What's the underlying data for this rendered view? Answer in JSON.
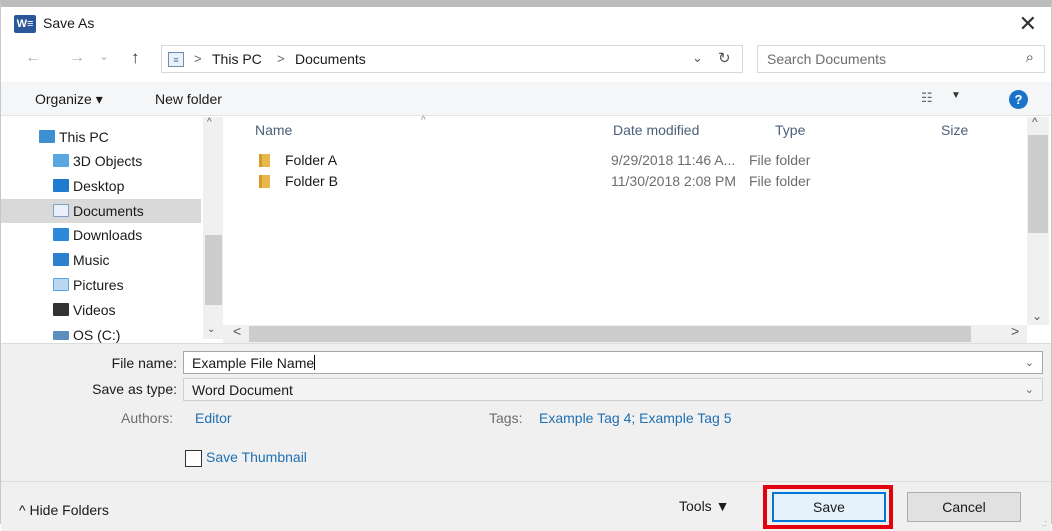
{
  "window": {
    "title": "Save As",
    "app_icon_text": "W≡",
    "close_glyph": "✕"
  },
  "nav": {
    "back_glyph": "←",
    "forward_glyph": "→",
    "recent_glyph": "⌄",
    "up_glyph": "↑",
    "address": {
      "crumbs": [
        "This PC",
        "Documents"
      ],
      "separator": ">",
      "dropdown_glyph": "⌄",
      "refresh_glyph": "↻"
    },
    "search": {
      "placeholder": "Search Documents",
      "icon_glyph": "⌕"
    }
  },
  "toolbar": {
    "organize_label": "Organize ▾",
    "new_folder_label": "New folder",
    "view_glyph": "☷",
    "view_caret": "▼",
    "help_glyph": "?"
  },
  "sidebar": {
    "items": [
      {
        "label": "This PC",
        "icon": "computer-icon",
        "color": "#3d8fd1"
      },
      {
        "label": "3D Objects",
        "icon": "cube-icon",
        "color": "#5aa6e0"
      },
      {
        "label": "Desktop",
        "icon": "desktop-icon",
        "color": "#1e7bd0"
      },
      {
        "label": "Documents",
        "icon": "documents-icon",
        "color": "#7f9dc0",
        "selected": true
      },
      {
        "label": "Downloads",
        "icon": "download-icon",
        "color": "#2d8ad8"
      },
      {
        "label": "Music",
        "icon": "music-icon",
        "color": "#2d7fd0"
      },
      {
        "label": "Pictures",
        "icon": "pictures-icon",
        "color": "#5aa6e0"
      },
      {
        "label": "Videos",
        "icon": "video-icon",
        "color": "#333333"
      },
      {
        "label": "OS (C:)",
        "icon": "drive-icon",
        "color": "#5a8fbf"
      }
    ],
    "scroll_up_glyph": "^",
    "scroll_down_glyph": "⌄"
  },
  "filelist": {
    "columns": [
      "Name",
      "Date modified",
      "Type",
      "Size"
    ],
    "sort_glyph": "^",
    "rows": [
      {
        "name": "Folder A",
        "date": "9/29/2018 11:46 A...",
        "type": "File folder"
      },
      {
        "name": "Folder B",
        "date": "11/30/2018 2:08 PM",
        "type": "File folder"
      }
    ],
    "scroll_left_glyph": "<",
    "scroll_right_glyph": ">",
    "scroll_up_glyph": "^",
    "scroll_down_glyph": "⌄"
  },
  "form": {
    "filename_label": "File name:",
    "filename_value": "Example File Name",
    "savetype_label": "Save as type:",
    "savetype_value": "Word Document",
    "dropdown_glyph": "⌄",
    "authors_label": "Authors:",
    "authors_value": "Editor",
    "tags_label": "Tags:",
    "tags_value": "Example Tag 4; Example Tag 5",
    "thumbnail_label": "Save Thumbnail",
    "thumbnail_checked": false
  },
  "footer": {
    "hide_folders_label": "^ Hide Folders",
    "tools_label": "Tools ▼",
    "save_label": "Save",
    "cancel_label": "Cancel",
    "grip_glyph": ".:"
  },
  "colors": {
    "accent": "#0078d7",
    "highlight_border": "#e3000f",
    "link": "#1f6fb2",
    "selected_row": "#d9d9d9"
  }
}
